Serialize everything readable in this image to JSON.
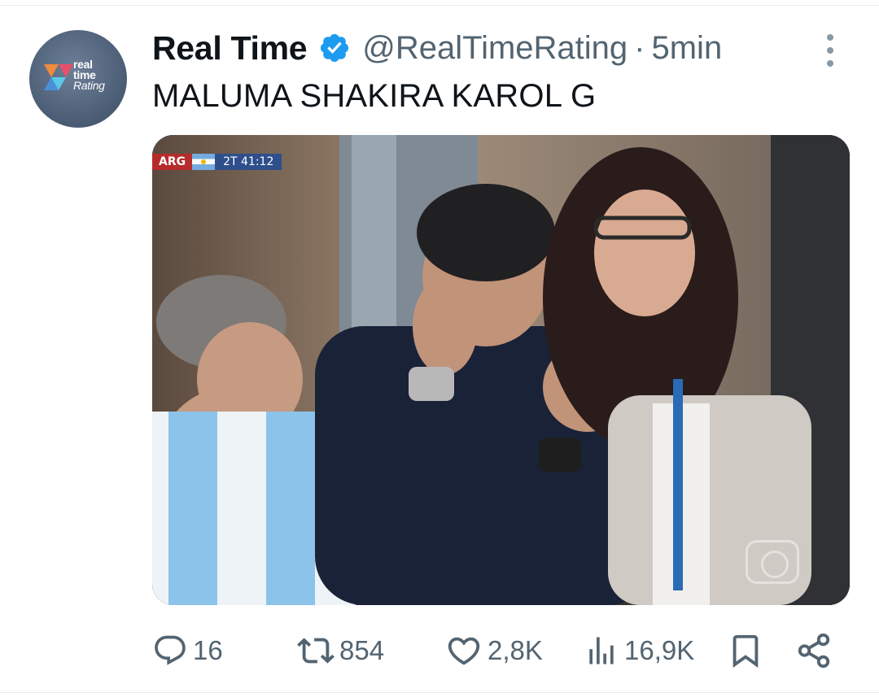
{
  "tweet": {
    "display_name": "Real Time",
    "handle": "@RealTimeRating",
    "separator": "·",
    "time": "5min",
    "text": "MALUMA SHAKIRA KAROL G",
    "avatar_logo": {
      "line1": "real",
      "line2": "time",
      "line3": "Rating"
    },
    "verified_color": "#1d9bf0"
  },
  "media": {
    "scorebug": {
      "team": "ARG",
      "clock": "2T 41:12"
    },
    "watermark_icon": "globo-icon"
  },
  "actions": {
    "replies": {
      "icon": "reply-icon",
      "count": "16"
    },
    "reposts": {
      "icon": "repost-icon",
      "count": "854"
    },
    "likes": {
      "icon": "heart-icon",
      "count": "2,8K"
    },
    "views": {
      "icon": "views-icon",
      "count": "16,9K"
    },
    "bookmark": {
      "icon": "bookmark-icon"
    },
    "share": {
      "icon": "share-icon"
    }
  },
  "colors": {
    "text": "#0f1419",
    "muted": "#536471",
    "accent": "#1d9bf0"
  }
}
